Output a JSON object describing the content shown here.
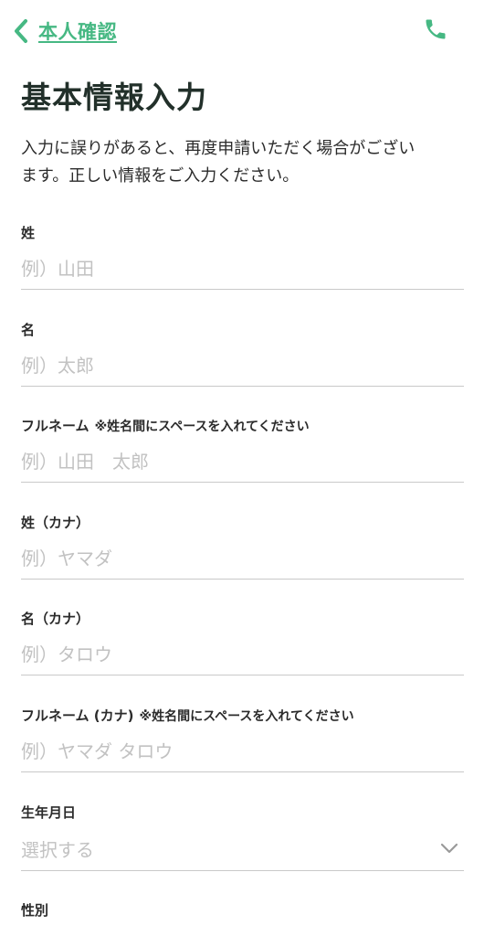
{
  "header": {
    "back_label": "本人確認",
    "back_icon": "chevron-left-icon",
    "phone_icon": "phone-icon",
    "accent": "#46b883"
  },
  "page": {
    "title": "基本情報入力",
    "notice_line1": "入力に誤りがあると、再度申請いただく場合がござい",
    "notice_line2": "ます。正しい情報をご入力ください。"
  },
  "form": {
    "last_name": {
      "label": "姓",
      "placeholder": "例）山田"
    },
    "first_name": {
      "label": "名",
      "placeholder": "例）太郎"
    },
    "full_name": {
      "label": "フルネーム",
      "note": "※姓名間にスペースを入れてください",
      "placeholder": "例）山田　太郎"
    },
    "last_name_kana": {
      "label": "姓（カナ）",
      "placeholder": "例）ヤマダ"
    },
    "first_name_kana": {
      "label": "名（カナ）",
      "placeholder": "例）タロウ"
    },
    "full_name_kana": {
      "label": "フルネーム (カナ)",
      "note": "※姓名間にスペースを入れてください",
      "placeholder": "例）ヤマダ タロウ"
    },
    "birthdate": {
      "label": "生年月日",
      "value": "選択する",
      "icon": "chevron-down-icon"
    },
    "gender": {
      "label": "性別"
    }
  }
}
